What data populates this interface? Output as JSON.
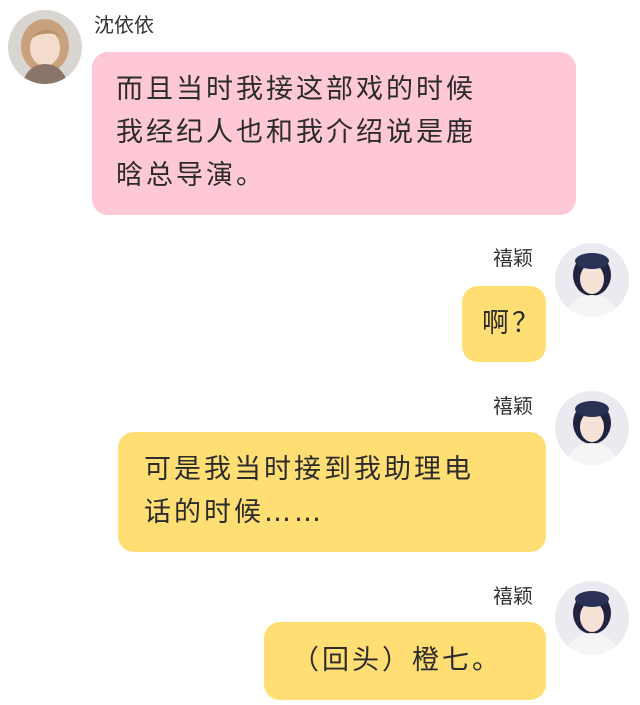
{
  "colors": {
    "left_bubble": "#FFC8D6",
    "right_bubble": "#FFDE73",
    "background": "#FFFFFF"
  },
  "messages": [
    {
      "side": "left",
      "sender": "沈依依",
      "avatar": "avatar-shen-yiyi",
      "lines": [
        "而且当时我接这部戏的时候",
        "我经纪人也和我介绍说是鹿",
        "晗总导演。"
      ]
    },
    {
      "side": "right",
      "sender": "禧颖",
      "avatar": "avatar-xi-ying",
      "lines": [
        "啊？"
      ]
    },
    {
      "side": "right",
      "sender": "禧颖",
      "avatar": "avatar-xi-ying",
      "lines": [
        "可是我当时接到我助理电",
        "话的时候……"
      ]
    },
    {
      "side": "right",
      "sender": "禧颖",
      "avatar": "avatar-xi-ying",
      "lines": [
        "（回头）橙七。"
      ]
    }
  ]
}
